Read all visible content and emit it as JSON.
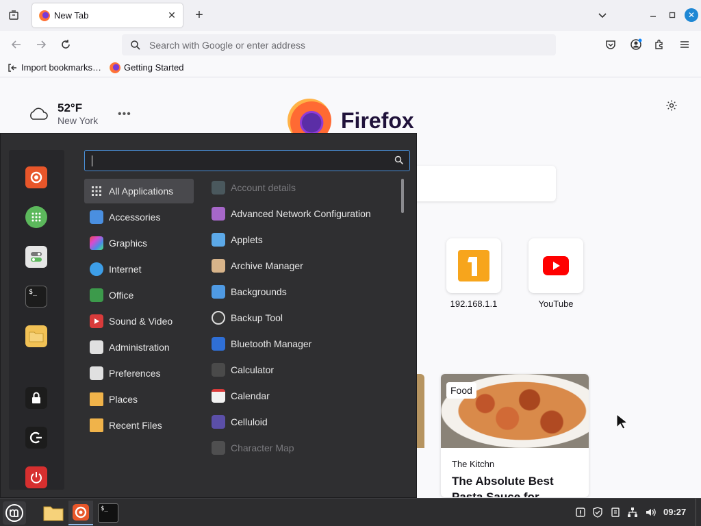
{
  "browser": {
    "tab": {
      "title": "New Tab"
    },
    "new_tab_symbol": "+",
    "urlbar": {
      "placeholder": "Search with Google or enter address"
    },
    "bookmarks": [
      {
        "label": "Import bookmarks…",
        "icon": "import-icon"
      },
      {
        "label": "Getting Started",
        "icon": "firefox-icon"
      }
    ]
  },
  "newtab": {
    "weather": {
      "temp": "52°F",
      "city": "New York"
    },
    "brand": "Firefox",
    "top_sites": [
      {
        "label": "192.168.1.1"
      },
      {
        "label": "YouTube"
      }
    ],
    "story": {
      "tag": "Food",
      "source": "The Kitchn",
      "title": "The Absolute Best Pasta Sauce for"
    }
  },
  "menu": {
    "search": {
      "value": ""
    },
    "categories": [
      {
        "label": "All Applications",
        "icon": "grid-icon",
        "active": true
      },
      {
        "label": "Accessories",
        "icon": "scissors-icon",
        "color": "#4a8fe0"
      },
      {
        "label": "Graphics",
        "icon": "graphics-icon",
        "color": "#c94bd1"
      },
      {
        "label": "Internet",
        "icon": "cloud-icon",
        "color": "#3d9ee8"
      },
      {
        "label": "Office",
        "icon": "office-icon",
        "color": "#3c9a4b"
      },
      {
        "label": "Sound & Video",
        "icon": "play-icon",
        "color": "#d93b3b"
      },
      {
        "label": "Administration",
        "icon": "toggle-icon",
        "color": "#e0e0e0"
      },
      {
        "label": "Preferences",
        "icon": "toggle-icon",
        "color": "#e0e0e0"
      },
      {
        "label": "Places",
        "icon": "folder-icon",
        "color": "#f0b34a"
      },
      {
        "label": "Recent Files",
        "icon": "recent-folder-icon",
        "color": "#f0b34a"
      }
    ],
    "apps": [
      {
        "label": "Account details",
        "color": "#6d8b95",
        "faded": true
      },
      {
        "label": "Advanced Network Configuration",
        "color": "#a667c9"
      },
      {
        "label": "Applets",
        "color": "#5ca9e8"
      },
      {
        "label": "Archive Manager",
        "color": "#d8b48a"
      },
      {
        "label": "Backgrounds",
        "color": "#4f9ae3"
      },
      {
        "label": "Backup Tool",
        "color": "#3a3a3a"
      },
      {
        "label": "Bluetooth Manager",
        "color": "#2f6fd6"
      },
      {
        "label": "Calculator",
        "color": "#4a4a4a"
      },
      {
        "label": "Calendar",
        "color": "#f2f2f2"
      },
      {
        "label": "Celluloid",
        "color": "#5b4fa8"
      },
      {
        "label": "Character Map",
        "color": "#777",
        "faded": true
      }
    ]
  },
  "taskbar": {
    "clock": "09:27"
  }
}
